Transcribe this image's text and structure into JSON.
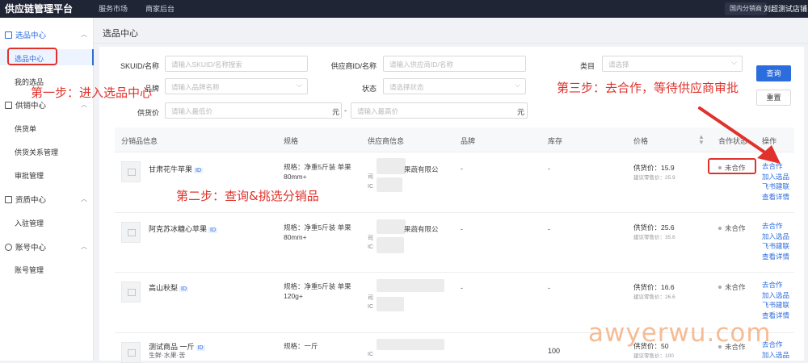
{
  "topbar": {
    "brand": "供应链管理平台",
    "nav": [
      "服务市场",
      "商家后台"
    ],
    "pill": "国内分销商",
    "user": "刘超测试店铺"
  },
  "sidebar": {
    "groups": [
      {
        "label": "选品中心",
        "items": [
          "选品中心",
          "我的选品"
        ]
      },
      {
        "label": "供销中心",
        "items": [
          "供货单",
          "供货关系管理",
          "审批管理"
        ]
      },
      {
        "label": "资质中心",
        "items": [
          "入驻管理"
        ]
      },
      {
        "label": "账号中心",
        "items": [
          "账号管理"
        ]
      }
    ]
  },
  "page": {
    "title": "选品中心"
  },
  "filters": {
    "skuid_label": "SKUID/名称",
    "skuid_placeholder": "请输入SKUID/名称搜索",
    "supplier_label": "供应商ID/名称",
    "supplier_placeholder": "请输入供应商ID/名称",
    "category_label": "类目",
    "category_placeholder": "请选择",
    "brand_label": "品牌",
    "brand_placeholder": "请输入品牌名称",
    "status_label": "状态",
    "status_placeholder": "请选择状态",
    "price_label": "供货价",
    "price_min_placeholder": "请输入最低价",
    "price_max_placeholder": "请输入最高价",
    "unit": "元",
    "range_sep": "-",
    "search_button": "查询",
    "reset_button": "重置"
  },
  "table": {
    "headers": [
      "分销品信息",
      "规格",
      "供应商信息",
      "品牌",
      "库存",
      "价格",
      "合作状态",
      "操作"
    ],
    "id_tag": "ID",
    "rows": [
      {
        "name": "甘肃花牛苹果",
        "sub": "",
        "spec": "规格：净重5斤装 单果80mm+",
        "supplier": "果蔬有限公",
        "brand": "-",
        "stock": "-",
        "price": "供货价：15.9",
        "retail": "建议零售价：25.9",
        "status": "未合作",
        "actions": [
          "去合作",
          "加入选品",
          "飞书建联",
          "查看详情"
        ]
      },
      {
        "name": "阿克苏冰糖心苹果",
        "sub": "",
        "spec": "规格：净重5斤装 单果80mm+",
        "supplier": "果蔬有限公",
        "brand": "-",
        "stock": "-",
        "price": "供货价：25.6",
        "retail": "建议零售价：35.6",
        "status": "未合作",
        "actions": [
          "去合作",
          "加入选品",
          "飞书建联",
          "查看详情"
        ]
      },
      {
        "name": "高山秋梨",
        "sub": "",
        "spec": "规格：净重5斤装 单果120g+",
        "supplier": "",
        "brand": "-",
        "stock": "-",
        "price": "供货价：16.6",
        "retail": "建议零售价：26.6",
        "status": "未合作",
        "actions": [
          "去合作",
          "加入选品",
          "飞书建联",
          "查看详情"
        ]
      },
      {
        "name": "测试商品 一斤",
        "sub": "生鲜·水果·苦",
        "spec": "规格：一斤",
        "supplier": "",
        "brand": "",
        "stock": "100",
        "price": "供货价：50",
        "retail": "建议零售价：100",
        "status": "未合作",
        "actions": [
          "去合作",
          "加入选品"
        ]
      }
    ]
  },
  "annotations": {
    "step1": "第一步：进入选品中心",
    "step2": "第二步：查询&挑选分销品",
    "step3": "第三步：去合作，等待供应商审批"
  },
  "watermark": "awyerwu.com",
  "colors": {
    "primary": "#2c6ddd",
    "annotation": "#e0322b",
    "topbar": "#1f2535"
  }
}
